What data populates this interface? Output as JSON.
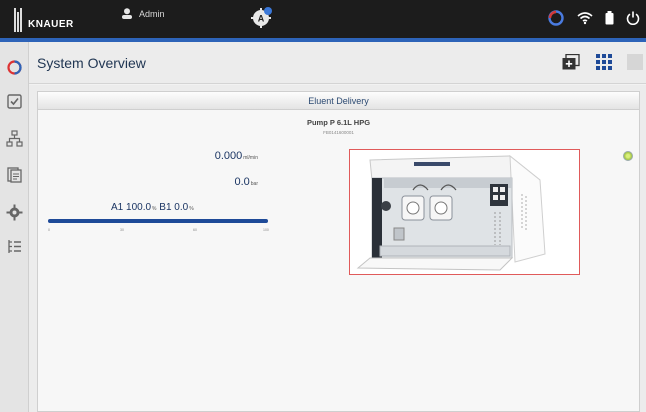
{
  "topbar": {
    "brand": "KNAUER",
    "user": "Admin",
    "badge_letter": "A",
    "colors": {
      "bar": "#1c1c1c",
      "accent": "#2d63b8"
    },
    "right_icons": [
      "connection-icon",
      "wifi-icon",
      "battery-icon",
      "power-icon"
    ]
  },
  "sidebar": {
    "items": [
      {
        "icon": "overview-ring-icon",
        "active": true
      },
      {
        "icon": "checklist-icon",
        "active": false
      },
      {
        "icon": "hierarchy-icon",
        "active": false
      },
      {
        "icon": "document-icon",
        "active": false
      },
      {
        "icon": "gear-icon",
        "active": false
      },
      {
        "icon": "list-tree-icon",
        "active": false
      }
    ]
  },
  "header": {
    "title": "System Overview",
    "icons": [
      "add-window-icon",
      "grid-view-icon",
      "tile-view-icon"
    ]
  },
  "panel": {
    "title": "Eluent Delivery",
    "device_name": "Pump P 6.1L HPG",
    "serial": "FB0141600001",
    "flow_value": "0.000",
    "flow_unit": "ml/min",
    "pressure_value": "0.0",
    "pressure_unit": "bar",
    "composition_a": "A1 100.0",
    "composition_b": "B1 0.0",
    "composition_unit": "%",
    "composition_a_fraction": 1.0,
    "scale_ticks": [
      "0",
      "30",
      "60",
      "100"
    ],
    "status_color": "#c8e35a"
  }
}
